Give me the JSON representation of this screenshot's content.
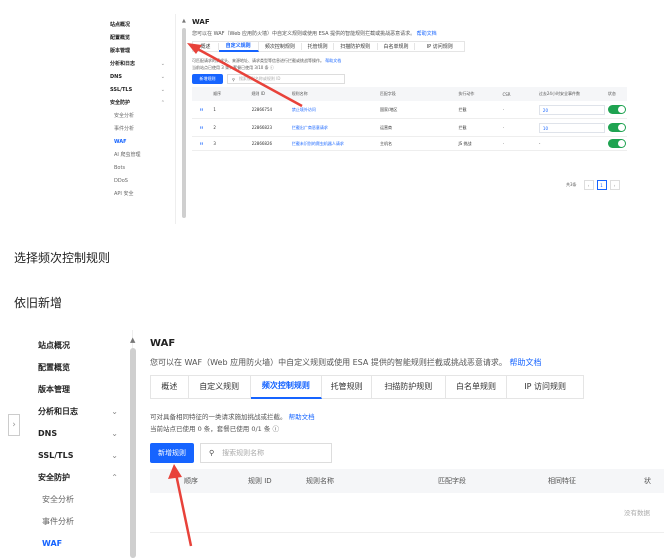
{
  "colors": {
    "accent": "#1664ff",
    "arrow": "#e8423a",
    "toggle_on": "#1fa351"
  },
  "sidebar": {
    "items": [
      {
        "label": "站点概况"
      },
      {
        "label": "配置概览"
      },
      {
        "label": "版本管理"
      },
      {
        "label": "分析和日志",
        "chevron": "⌄"
      },
      {
        "label": "DNS",
        "chevron": "⌄"
      },
      {
        "label": "SSL/TLS",
        "chevron": "⌄"
      },
      {
        "label": "安全防护",
        "chevron": "⌃"
      }
    ],
    "sub_items_1": [
      "安全分析",
      "事件分析",
      "WAF",
      "AI 爬虫管理",
      "Bots",
      "DDoS",
      "API 安全"
    ],
    "sub_items_2": [
      "安全分析",
      "事件分析",
      "WAF"
    ],
    "active_sub": "WAF"
  },
  "page": {
    "title": "WAF",
    "description": "您可以在 WAF（Web 应用防火墙）中自定义规则或使用 ESA 提供的智能规则拦截或挑战恶意请求。",
    "help_link": "帮助文档",
    "tabs": [
      "概述",
      "自定义规则",
      "频次控制规则",
      "托管规则",
      "扫描防护规则",
      "白名单规则",
      "IP 访问规则"
    ]
  },
  "shot1": {
    "active_tab": "自定义规则",
    "intro": "可匹配请求的请求头、来源地址、请求类型等信息进行拦截或挑战等操作。",
    "intro_link": "帮助文档",
    "usage": "当前站点已使用 3 条，套餐已使用 3/10 条",
    "add_button": "新增规则",
    "search_placeholder": "搜索规则名称或规则 ID",
    "columns": [
      "顺序",
      "规则 ID",
      "规则名称",
      "匹配字段",
      "执行动作",
      "CSR",
      "过去24小时安全事件数",
      "状态"
    ],
    "rows": [
      {
        "order": "1",
        "id": "22866754",
        "name": "禁止境外访问",
        "field": "国家/地区",
        "action": "拦截",
        "csr": "-",
        "events": "20"
      },
      {
        "order": "2",
        "id": "22866823",
        "name": "拦截出广商恶意请求",
        "field": "运营商",
        "action": "拦截",
        "csr": "-",
        "events": "10"
      },
      {
        "order": "3",
        "id": "22866826",
        "name": "拦截未识别的爬虫机器人请求",
        "field": "主机名",
        "action": "JS 挑战",
        "csr": "-",
        "events": "-"
      }
    ],
    "total": "共3条",
    "page": "1"
  },
  "caption1": "选择频次控制规则",
  "caption2": "依旧新增",
  "shot2": {
    "active_tab": "频次控制规则",
    "intro": "可对具备相同特征的一类请求施加挑战或拦截。",
    "intro_link": "帮助文档",
    "usage": "当前站点已使用 0 条，套餐已使用 0/1 条",
    "add_button": "新增规则",
    "search_placeholder": "搜索规则名称",
    "columns": [
      "顺序",
      "规则 ID",
      "规则名称",
      "匹配字段",
      "相同特征",
      "状"
    ],
    "empty": "没有数据"
  },
  "icons": {
    "search": "search-icon",
    "drag": "drag-handle-icon",
    "info": "info-icon",
    "chevron_left": "chevron-left-icon",
    "chevron_right": "chevron-right-icon",
    "scroll_up": "scroll-up-icon",
    "sidebar_toggle": "sidebar-collapse-icon"
  }
}
